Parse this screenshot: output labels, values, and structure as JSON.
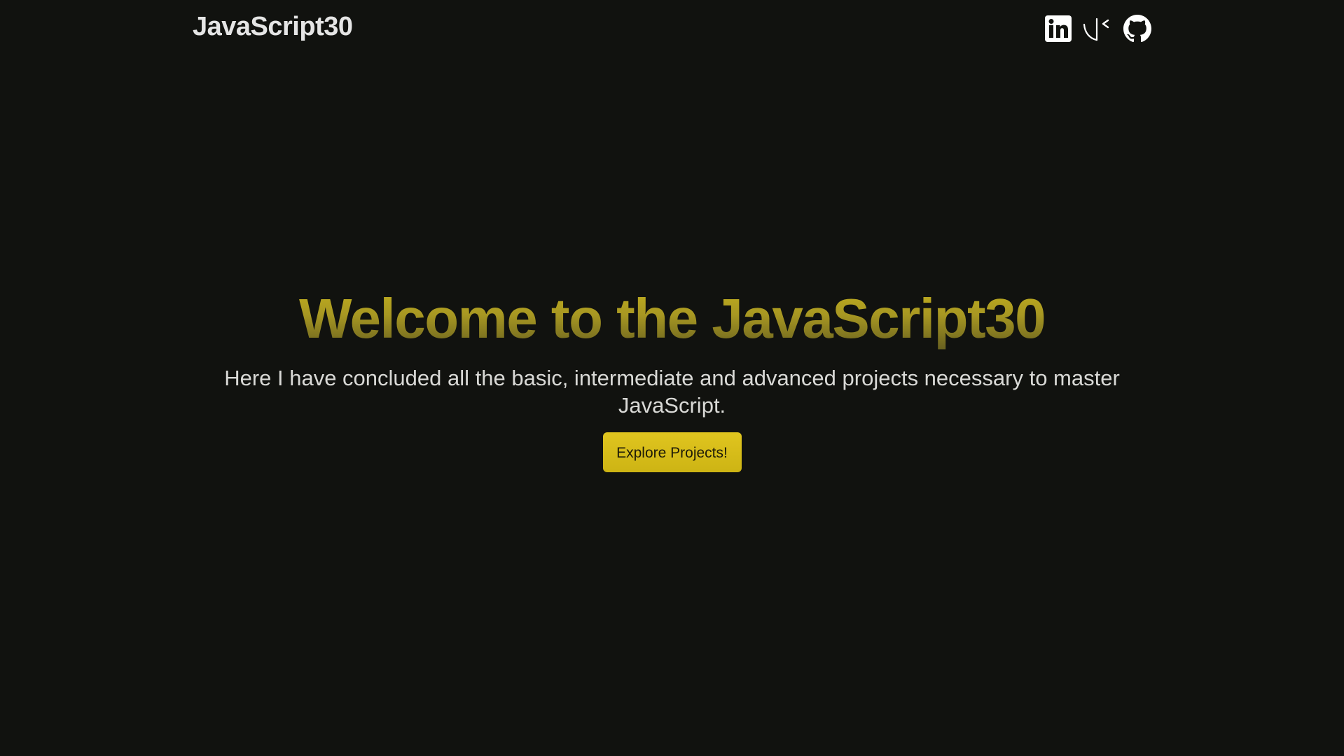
{
  "header": {
    "brand": "JavaScript30",
    "social_links": [
      {
        "icon": "linkedin-icon"
      },
      {
        "icon": "hashnode-icon"
      },
      {
        "icon": "github-icon"
      }
    ]
  },
  "hero": {
    "title": "Welcome to the JavaScript30",
    "subtitle": "Here I have concluded all the basic, intermediate and advanced projects necessary to master JavaScript.",
    "cta_label": "Explore Projects!"
  },
  "colors": {
    "background": "#11120f",
    "accent": "#d9bf1a",
    "text": "#e5e5e5"
  }
}
